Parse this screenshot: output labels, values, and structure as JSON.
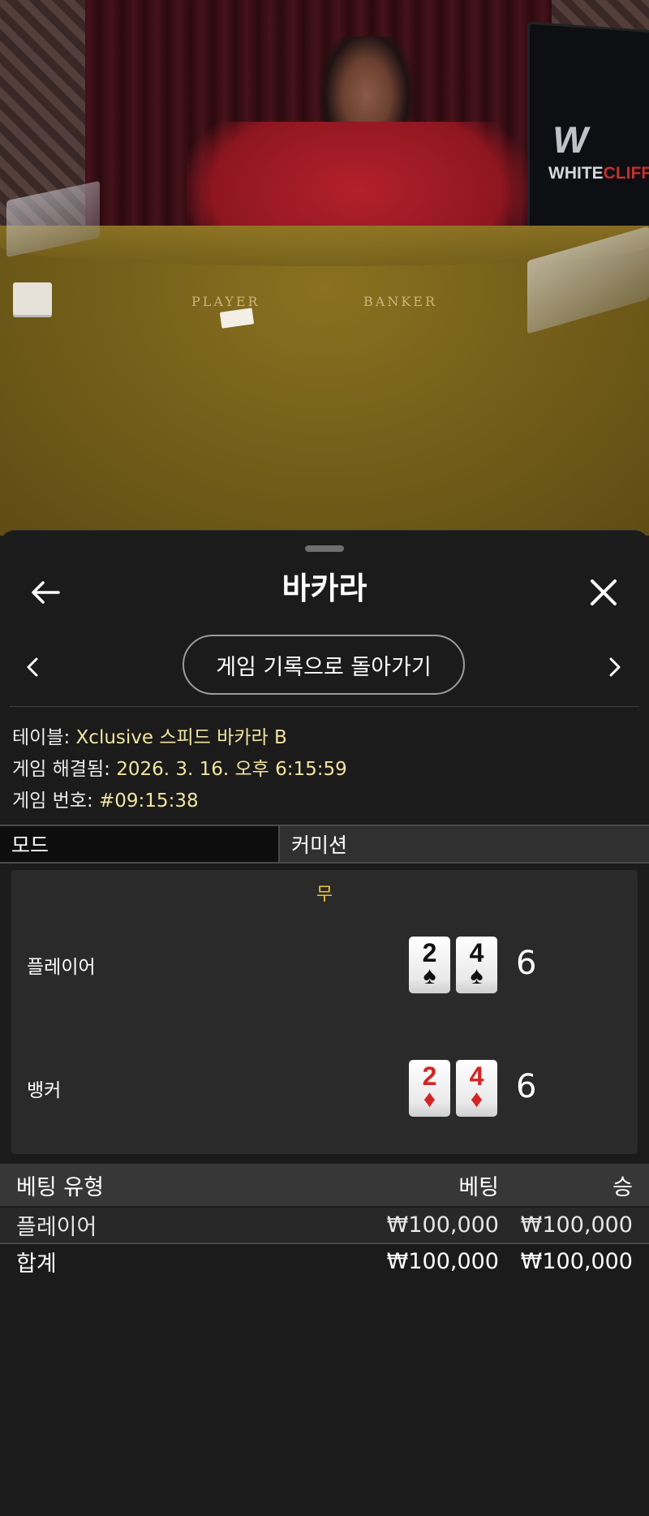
{
  "video": {
    "table_labels": {
      "player": "PLAYER",
      "banker": "BANKER"
    },
    "brand": {
      "mark": "W",
      "name_white": "WHITE",
      "name_red": "CLIFF"
    }
  },
  "sheet": {
    "title": "바카라",
    "history_button": "게임 기록으로 돌아가기",
    "info": {
      "table_label": "테이블:",
      "table_value": "Xclusive 스피드 바카라 B",
      "resolved_label": "게임 해결됨:",
      "resolved_value": "2026. 3. 16. 오후 6:15:59",
      "game_no_label": "게임 번호:",
      "game_no_value": "#09:15:38"
    },
    "tabs": {
      "mode": "모드",
      "commission": "커미션"
    },
    "result": {
      "outcome": "무",
      "player": {
        "label": "플레이어",
        "cards": [
          {
            "rank": "2",
            "suit": "♠"
          },
          {
            "rank": "4",
            "suit": "♠"
          }
        ],
        "score": "6"
      },
      "banker": {
        "label": "뱅커",
        "cards": [
          {
            "rank": "2",
            "suit": "♦"
          },
          {
            "rank": "4",
            "suit": "♦"
          }
        ],
        "score": "6"
      }
    },
    "bets": {
      "headers": {
        "type": "베팅 유형",
        "bet": "베팅",
        "win": "승"
      },
      "rows": [
        {
          "type": "플레이어",
          "bet": "₩100,000",
          "win": "₩100,000"
        }
      ],
      "total": {
        "label": "합계",
        "bet": "₩100,000",
        "win": "₩100,000"
      }
    }
  },
  "icons": {
    "back": "arrow-left-icon",
    "close": "close-icon",
    "prev": "chevron-left-icon",
    "next": "chevron-right-icon"
  },
  "colors": {
    "sheet_bg": "#1b1b1b",
    "info_value": "#f2e3a0",
    "outcome_tie": "#e8c730",
    "red_suit": "#d42424"
  }
}
